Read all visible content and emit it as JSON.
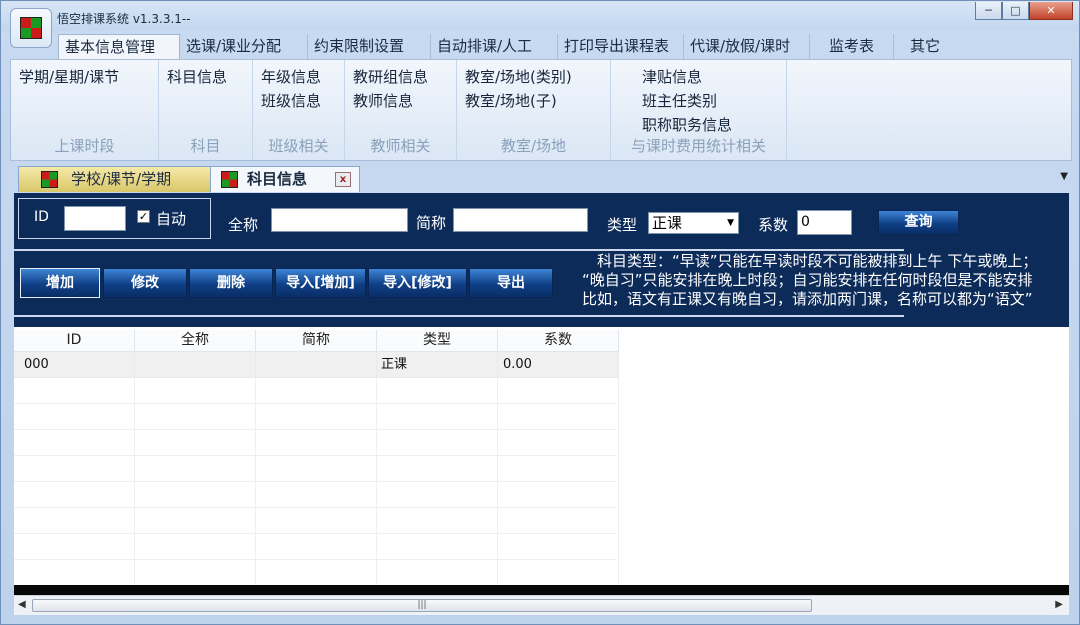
{
  "window": {
    "title": "悟空排课系统 v1.3.3.1--",
    "minimize_glyph": "─",
    "maximize_glyph": "□",
    "close_glyph": "✕",
    "logo_colors": [
      "#cc1b1b",
      "#1a9a22",
      "#1a9a22",
      "#cc1b1b"
    ]
  },
  "menu_tabs": [
    {
      "label": "基本信息管理",
      "active": true
    },
    {
      "label": "选课/课业分配"
    },
    {
      "label": "约束限制设置"
    },
    {
      "label": "自动排课/人工"
    },
    {
      "label": "打印导出课程表"
    },
    {
      "label": "代课/放假/课时"
    },
    {
      "label": "监考表"
    },
    {
      "label": "其它"
    }
  ],
  "ribbon_groups": [
    {
      "title": "上课时段",
      "items": [
        "学期/星期/课节"
      ]
    },
    {
      "title": "科目",
      "items": [
        "科目信息"
      ]
    },
    {
      "title": "班级相关",
      "items": [
        "年级信息",
        "班级信息"
      ]
    },
    {
      "title": "教师相关",
      "items": [
        "教研组信息",
        "教师信息"
      ]
    },
    {
      "title": "教室/场地",
      "items": [
        "教室/场地(类别)",
        "教室/场地(子)"
      ]
    },
    {
      "title": "与课时费用统计相关",
      "items": [
        "津贴信息",
        "班主任类别",
        "职称职务信息"
      ]
    }
  ],
  "doc_tabs": [
    {
      "label": "学校/课节/学期"
    },
    {
      "label": "科目信息",
      "close": "x"
    }
  ],
  "form": {
    "id_label": "ID",
    "id_value": "",
    "auto_label": "自动",
    "auto_checked": "✓",
    "fullname_label": "全称",
    "fullname_value": "",
    "shortname_label": "简称",
    "shortname_value": "",
    "type_label": "类型",
    "type_value": "正课",
    "coef_label": "系数",
    "coef_value": "0",
    "query_button": "查询"
  },
  "actions": [
    "增加",
    "修改",
    "删除",
    "导入[增加]",
    "导入[修改]",
    "导出"
  ],
  "hint_lines": [
    "　科目类型：“早读”只能在早读时段不可能被排到上午 下午或晚上；",
    "“晚自习”只能安排在晚上时段；自习能安排在任何时段但是不能安排",
    "比如，语文有正课又有晚自习，请添加两门课，名称可以都为“语文”"
  ],
  "grid": {
    "columns": [
      "ID",
      "全称",
      "简称",
      "类型",
      "系数"
    ],
    "rows": [
      [
        "000",
        "",
        "",
        "正课",
        "0.00"
      ]
    ]
  },
  "scrollbar": {
    "thumb_grip": "|||",
    "left_arrow": "◀",
    "right_arrow": "▶"
  },
  "tabs_overflow_glyph": "▼"
}
